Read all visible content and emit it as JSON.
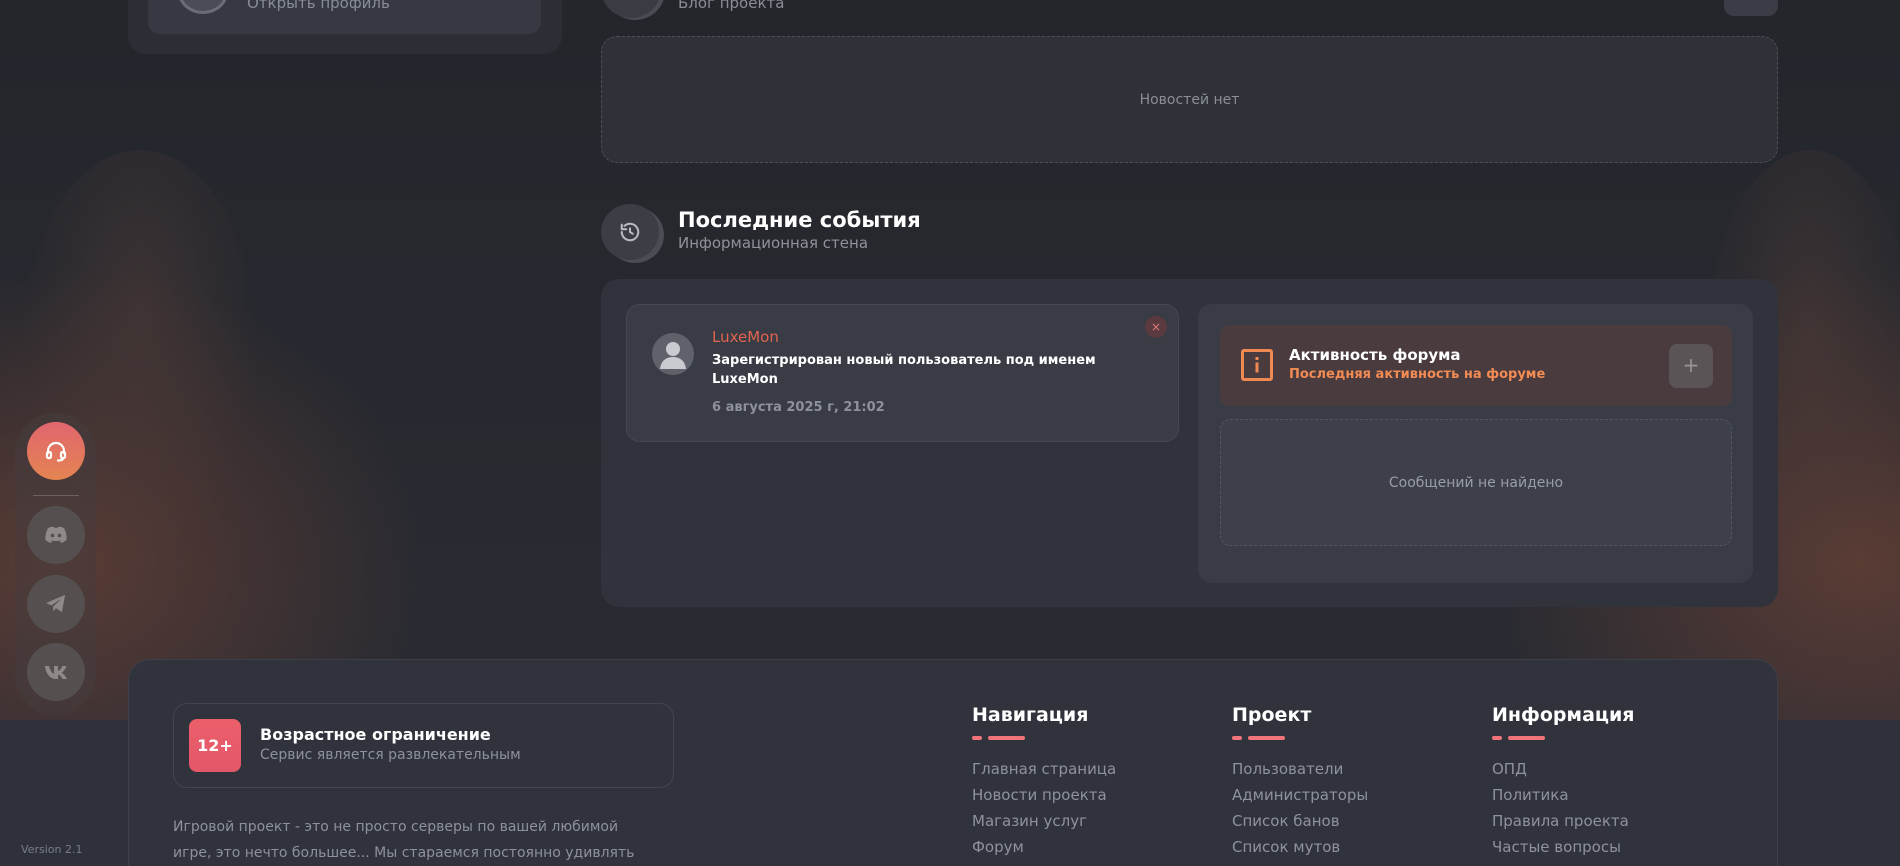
{
  "profile": {
    "open_profile_label": "Открыть профиль"
  },
  "blog": {
    "subtitle": "Блог проекта",
    "empty_text": "Новостей нет"
  },
  "events": {
    "title": "Последние события",
    "subtitle": "Информационная стена",
    "items": [
      {
        "user": "LuxeMon",
        "text": "Зарегистрирован новый пользователь под именем LuxeMon",
        "date": "6 августа 2025 г, 21:02",
        "close_symbol": "×"
      }
    ]
  },
  "forum": {
    "title": "Активность форума",
    "subtitle": "Последняя активность на форуме",
    "add_symbol": "+",
    "empty_text": "Сообщений не найдено"
  },
  "social": {
    "icons": [
      "headset-icon",
      "discord-icon",
      "telegram-icon",
      "vk-icon"
    ]
  },
  "version": "Version 2.1",
  "footer": {
    "age": {
      "badge": "12+",
      "title": "Возрастное ограничение",
      "subtitle": "Сервис является развлекательным"
    },
    "about_line1": "Игровой проект - это не просто серверы по вашей любимой",
    "about_line2": "игре, это нечто большее... Мы стараемся постоянно удивлять",
    "columns": [
      {
        "title": "Навигация",
        "links": [
          "Главная страница",
          "Новости проекта",
          "Магазин услуг",
          "Форум"
        ]
      },
      {
        "title": "Проект",
        "links": [
          "Пользователи",
          "Администраторы",
          "Список банов",
          "Список мутов"
        ]
      },
      {
        "title": "Информация",
        "links": [
          "ОПД",
          "Политика",
          "Правила проекта",
          "Частые вопросы"
        ]
      }
    ]
  },
  "colors": {
    "accent_orange": "#f38b54",
    "accent_red": "#e2634f",
    "accent_pink": "#f07479",
    "page_bg": "#262830"
  }
}
